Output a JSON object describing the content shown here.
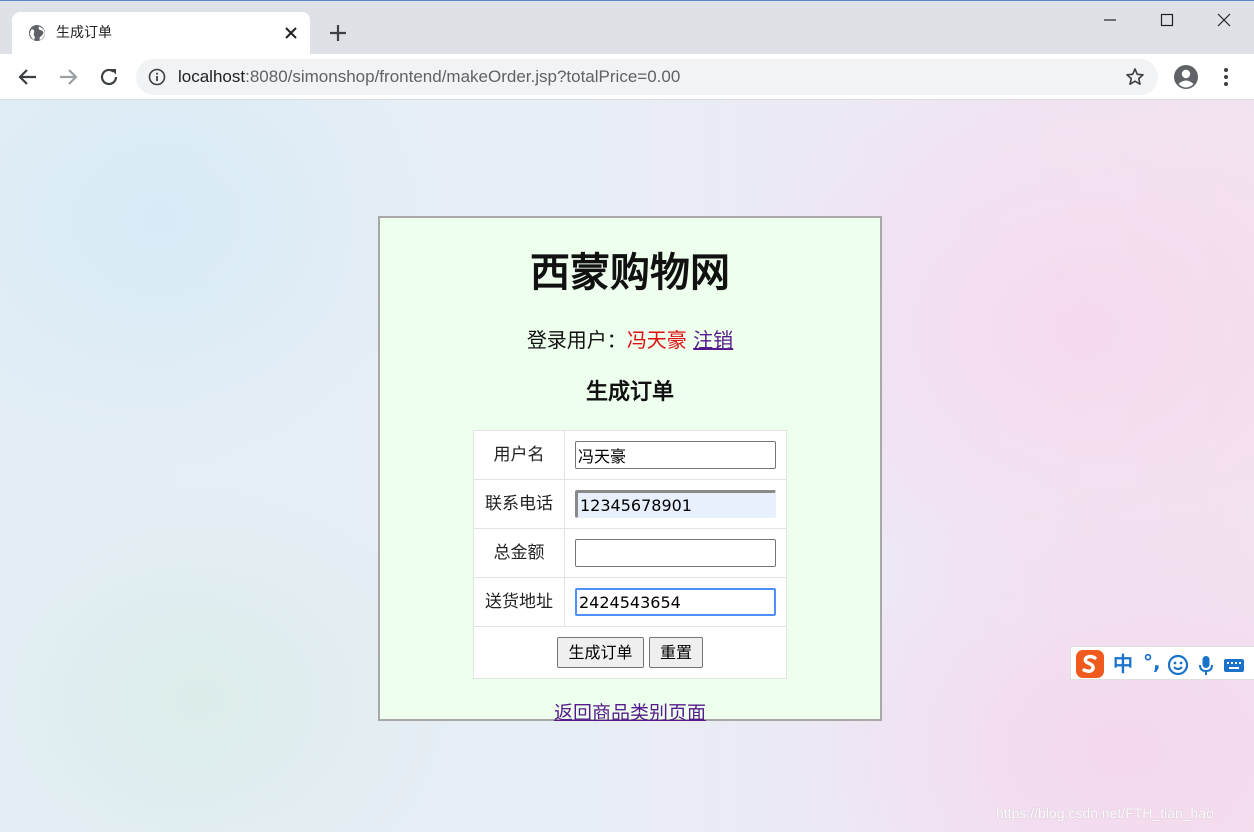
{
  "browser": {
    "tab_title": "生成订单",
    "url_host": "localhost",
    "url_rest": ":8080/simonshop/frontend/makeOrder.jsp?totalPrice=0.00"
  },
  "header": {
    "site_title": "西蒙购物网",
    "login_label": "登录用户：",
    "username": "冯天豪",
    "logout_link": "注销"
  },
  "form": {
    "heading": "生成订单",
    "fields": [
      {
        "label": "用户名",
        "value": "冯天豪"
      },
      {
        "label": "联系电话",
        "value": "12345678901"
      },
      {
        "label": "总金额",
        "value": ""
      },
      {
        "label": "送货地址",
        "value": "2424543654"
      }
    ],
    "submit_label": "生成订单",
    "reset_label": "重置"
  },
  "footer": {
    "back_link": "返回商品类别页面"
  },
  "ime": {
    "mode": "中",
    "punct": "°,"
  },
  "watermark": "https://blog.csdn.net/FTH_tian_hao",
  "colors": {
    "username": "#dd1111",
    "link": "#551a8b",
    "container_bg": "#eeffee",
    "ime_accent": "#1a73c8"
  }
}
